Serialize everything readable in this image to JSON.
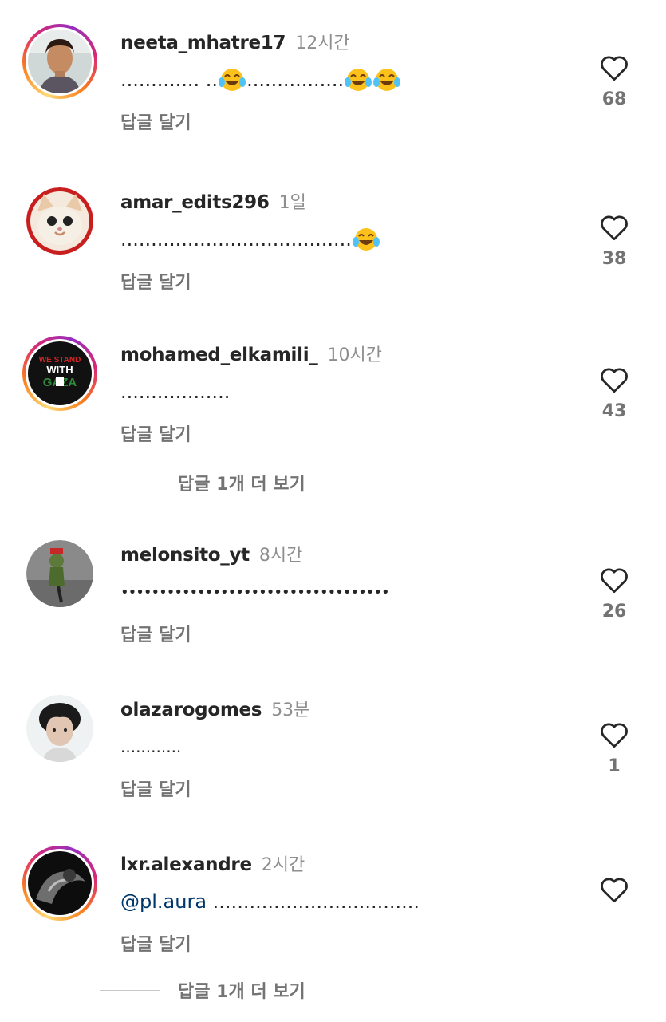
{
  "comments": [
    {
      "username": "neeta_mhatre17",
      "time": "12시간",
      "text_parts": [
        "............. ..",
        "emoji",
        "................",
        "emoji",
        "emoji"
      ],
      "reply_label": "답글 달기",
      "likes": "68",
      "story_ring": true
    },
    {
      "username": "amar_edits296",
      "time": "1일",
      "text_parts": [
        "......................................",
        "emoji"
      ],
      "reply_label": "답글 달기",
      "likes": "38",
      "story_ring": false
    },
    {
      "username": "mohamed_elkamili_",
      "time": "10시간",
      "text_parts": [
        ".................."
      ],
      "reply_label": "답글 달기",
      "likes": "43",
      "story_ring": true
    },
    {
      "username": "melonsito_yt",
      "time": "8시간",
      "text_parts": [
        "•••••••••••••••••••••••••••••••••••"
      ],
      "reply_label": "답글 달기",
      "likes": "26",
      "story_ring": false
    },
    {
      "username": "olazarogomes",
      "time": "53분",
      "text_parts": [
        "............"
      ],
      "reply_label": "답글 달기",
      "likes": "1",
      "story_ring": false
    },
    {
      "username": "lxr.alexandre",
      "time": "2시간",
      "mention": "@pl.aura",
      "text_parts": [
        ".................................."
      ],
      "reply_label": "답글 달기",
      "likes": "",
      "story_ring": true
    }
  ],
  "view_more_replies": [
    "답글 1개 더 보기",
    "답글 1개 더 보기"
  ],
  "avatar_texts": {
    "gaza_line1": "WE STAND",
    "gaza_line2": "WITH",
    "gaza_line3": "GAZA"
  },
  "icons": {
    "like": "heart-outline-icon",
    "emoji": "face-with-tears-of-joy-icon"
  },
  "colors": {
    "text": "#262626",
    "secondary": "#737373",
    "time": "#8e8e8e",
    "mention": "#00376b"
  }
}
